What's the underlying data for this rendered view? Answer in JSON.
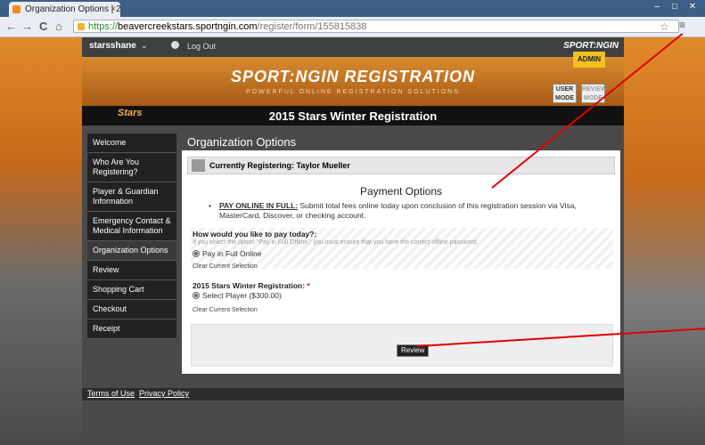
{
  "browser": {
    "tab_title": "Organization Options | 20",
    "tab_close": "×",
    "url_scheme": "https://",
    "url_host": "beavercreekstars.sportngin.com",
    "url_path": "/register/form/155815838",
    "nav_back": "←",
    "nav_forward": "→",
    "nav_reload": "C",
    "nav_home": "⌂",
    "bookmark_star": "☆",
    "menu_icon": "≡",
    "win_min": "–",
    "win_max": "□",
    "win_close": "✕"
  },
  "topbar": {
    "username": "starsshane",
    "logout": "Log Out",
    "brand_small": "SPORT:NGIN"
  },
  "banner": {
    "title": "SPORT:NGIN REGISTRATION",
    "subtitle": "POWERFUL ONLINE REGISTRATION SOLUTIONS",
    "admin_badge": "ADMIN",
    "user_mode": "USER MODE",
    "review_mode": "REVIEW MODE"
  },
  "regbar": {
    "logo": "Stars",
    "title": "2015 Stars Winter Registration"
  },
  "sidebar": {
    "items": [
      {
        "label": "Welcome"
      },
      {
        "label": "Who Are You Registering?"
      },
      {
        "label": "Player & Guardian Information"
      },
      {
        "label": "Emergency Contact & Medical Information"
      },
      {
        "label": "Organization Options"
      },
      {
        "label": "Review"
      },
      {
        "label": "Shopping Cart"
      },
      {
        "label": "Checkout"
      },
      {
        "label": "Receipt"
      }
    ]
  },
  "panel": {
    "heading": "Organization Options",
    "currently": "Currently Registering: Taylor Mueller",
    "payment_heading": "Payment Options",
    "pay_online_bold": "PAY ONLINE IN FULL:",
    "pay_online_text": " Submit total fees online today upon conclusion of this registration session via Visa, MasterCard, Discover, or checking account.",
    "question": "How would you like to pay today?:",
    "note": "If you select the option \"Pay in Full Offline,\" you must ensure that you have the correct offline password.",
    "option_pay_full": "Pay in Full Online",
    "clear_1": "Clear Current Selection",
    "reg_label": "2015 Stars Winter Registration:",
    "required_mark": "*",
    "option_select_player": "Select Player ($300.00)",
    "clear_2": "Clear Current Selection",
    "review_button": "Review"
  },
  "footer": {
    "terms": "Terms of Use",
    "privacy": "Privacy Policy"
  },
  "colors": {
    "accent_orange": "#d98b2f",
    "arrow_red": "#e00000",
    "sidebar_bg": "#222222"
  }
}
